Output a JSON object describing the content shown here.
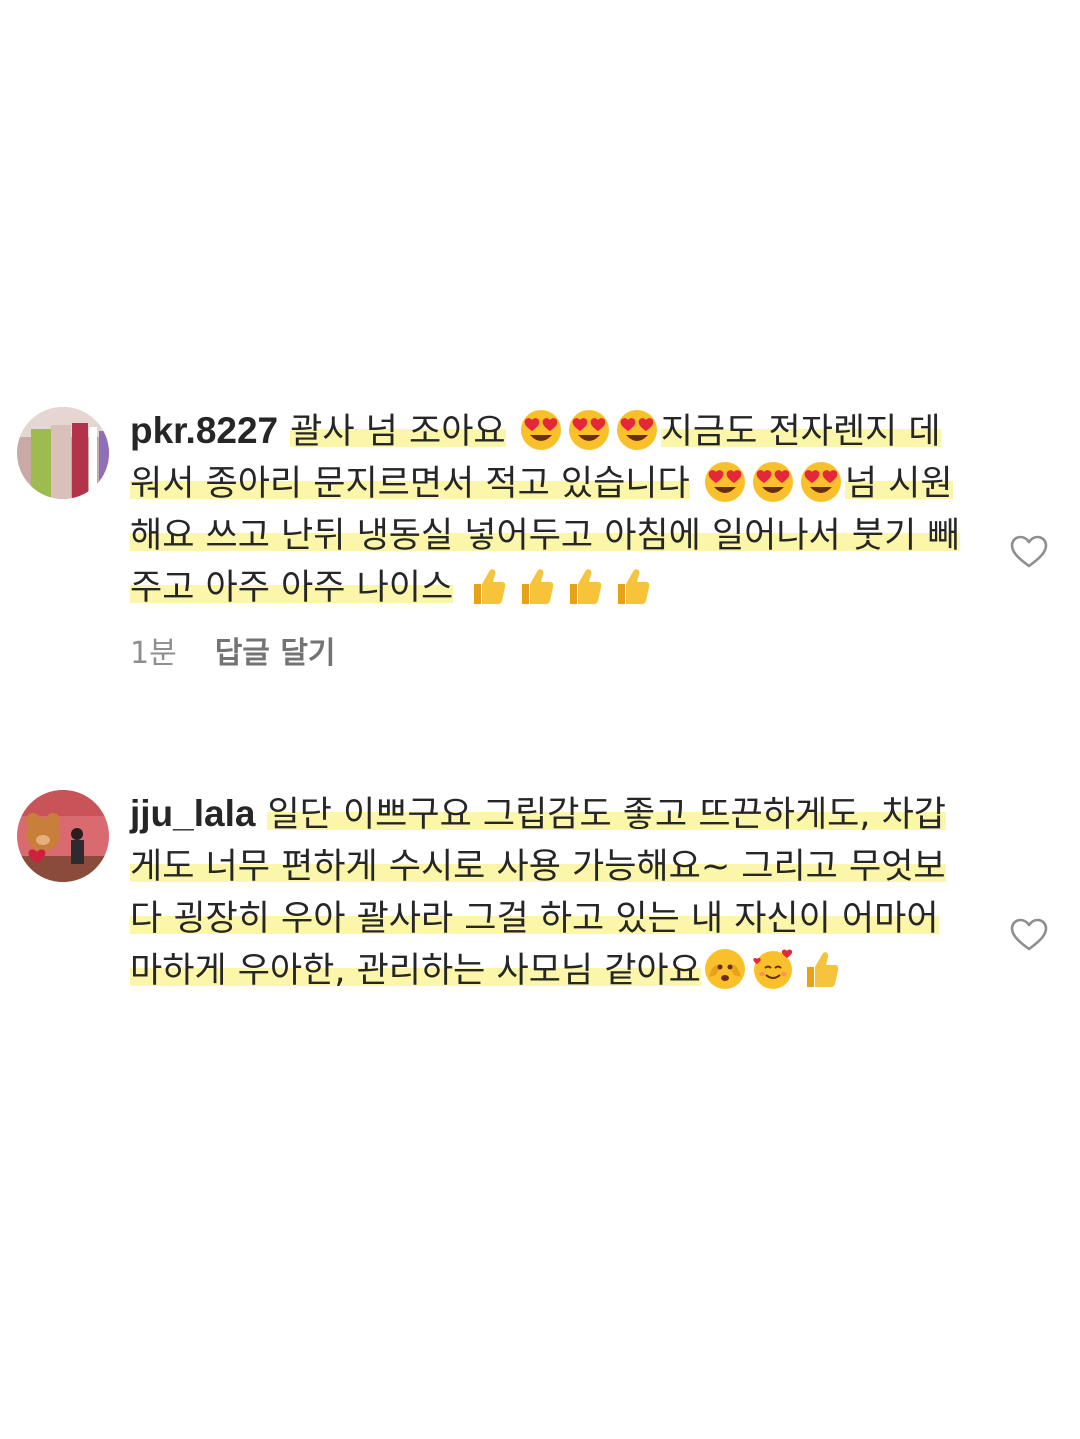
{
  "comments": [
    {
      "username": "pkr.8227",
      "text_lead": "괄사 넘 조아요",
      "text_line_a": "지금도 전자렌지 데워서 종아리 문지르면서 적고 있습니다",
      "text_line_b": "넘 시원 해요 쓰고 난뒤 냉동실 넣어두고 아침에 일어나서 붓기 빼주고 아주 아주 나이스",
      "time": "1분",
      "reply_label": "답글 달기",
      "avatar_icon": "product-photo-avatar",
      "like_icon": "heart-outline-icon"
    },
    {
      "username": "jju_lala",
      "text_main": "일단 이쁘구요 그립감도 좋고 뜨끈하게도, 차갑게도 너무 편하게 수시로 사용 가능해요~ 그리고 무엇보다 굉장히 우아 괄사라 그걸 하고 있는 내 자신이 어마어마하게 우아한, 관리하는 사모님 같아요",
      "avatar_icon": "teddy-bear-photo-avatar",
      "like_icon": "heart-outline-icon"
    }
  ],
  "colors": {
    "highlight": "#fbf6a9",
    "meta_text": "#8e8e8e",
    "text": "#262626"
  }
}
